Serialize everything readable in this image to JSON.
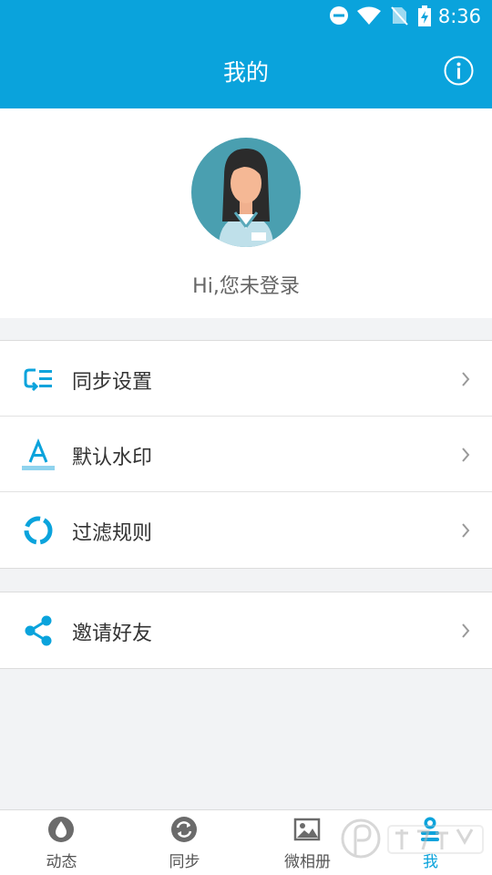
{
  "status_bar": {
    "time": "8:36"
  },
  "header": {
    "title": "我的"
  },
  "profile": {
    "greeting": "Hi,您未登录"
  },
  "menu_group_1": [
    {
      "label": "同步设置",
      "icon": "sync-settings-icon"
    },
    {
      "label": "默认水印",
      "icon": "watermark-icon"
    },
    {
      "label": "过滤规则",
      "icon": "filter-rule-icon"
    }
  ],
  "menu_group_2": [
    {
      "label": "邀请好友",
      "icon": "share-icon"
    }
  ],
  "tabs": [
    {
      "label": "动态",
      "icon": "drop-icon",
      "active": false
    },
    {
      "label": "同步",
      "icon": "sync-icon",
      "active": false
    },
    {
      "label": "微相册",
      "icon": "image-icon",
      "active": false
    },
    {
      "label": "我",
      "icon": "person-icon",
      "active": true
    }
  ],
  "colors": {
    "accent": "#0aa3dc",
    "background": "#f2f3f5"
  }
}
